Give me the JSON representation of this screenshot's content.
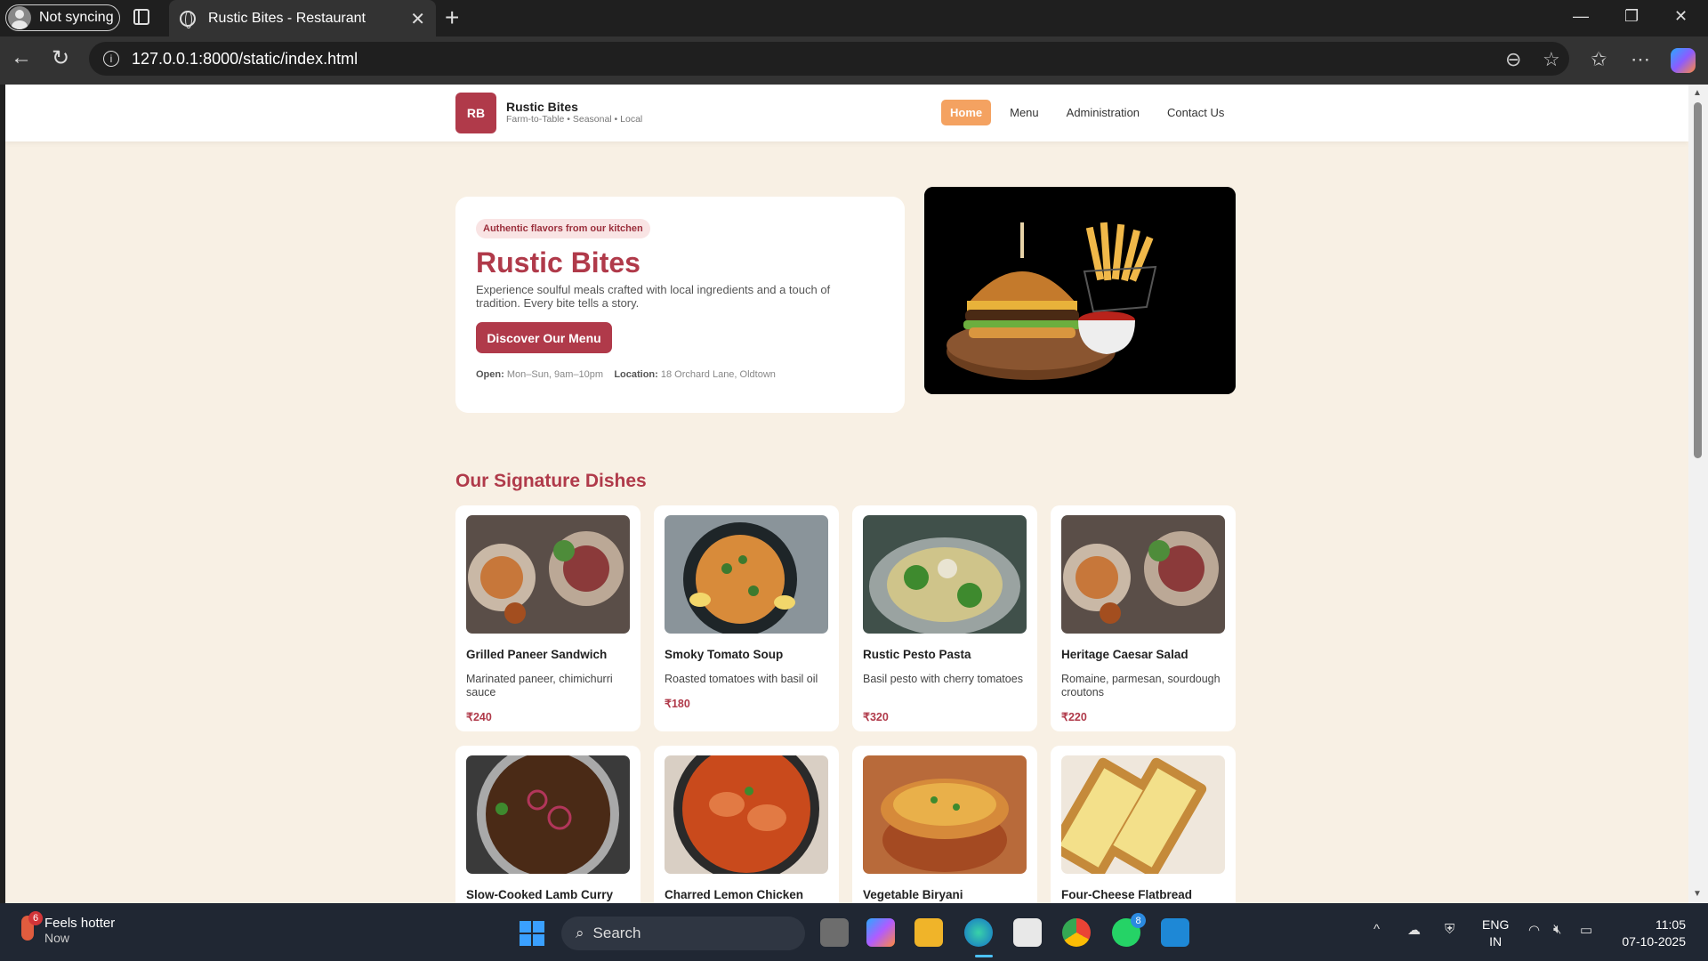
{
  "browser": {
    "profile_label": "Not syncing",
    "tab_title": "Rustic Bites - Restaurant",
    "url": "127.0.0.1:8000/static/index.html"
  },
  "site": {
    "logo_text": "RB",
    "brand_name": "Rustic Bites",
    "brand_tagline": "Farm-to-Table • Seasonal • Local",
    "nav": [
      {
        "label": "Home",
        "active": true
      },
      {
        "label": "Menu",
        "active": false
      },
      {
        "label": "Administration",
        "active": false
      },
      {
        "label": "Contact Us",
        "active": false
      }
    ],
    "accent_color": "#b03a4a",
    "nav_active_color": "#f4a261",
    "background_color": "#f8f0e4"
  },
  "hero": {
    "pill": "Authentic flavors from our kitchen",
    "title": "Rustic Bites",
    "description": "Experience soulful meals crafted with local ingredients and a touch of tradition. Every bite tells a story.",
    "cta_label": "Discover Our Menu",
    "open_label": "Open:",
    "open_value": "Mon–Sun, 9am–10pm",
    "location_label": "Location:",
    "location_value": "18 Orchard Lane, Oldtown"
  },
  "signature": {
    "title": "Our Signature Dishes",
    "dishes": [
      {
        "name": "Grilled Paneer Sandwich",
        "desc": "Marinated paneer, chimichurri sauce",
        "price": "₹240"
      },
      {
        "name": "Smoky Tomato Soup",
        "desc": "Roasted tomatoes with basil oil",
        "price": "₹180"
      },
      {
        "name": "Rustic Pesto Pasta",
        "desc": "Basil pesto with cherry tomatoes",
        "price": "₹320"
      },
      {
        "name": "Heritage Caesar Salad",
        "desc": "Romaine, parmesan, sourdough croutons",
        "price": "₹220"
      },
      {
        "name": "Slow-Cooked Lamb Curry"
      },
      {
        "name": "Charred Lemon Chicken"
      },
      {
        "name": "Vegetable Biryani"
      },
      {
        "name": "Four-Cheese Flatbread"
      }
    ]
  },
  "taskbar": {
    "weather_badge": "6",
    "weather_title": "Feels hotter",
    "weather_sub": "Now",
    "search_label": "Search",
    "whatsapp_badge": "8",
    "lang_top": "ENG",
    "lang_bottom": "IN",
    "time": "11:05",
    "date": "07-10-2025"
  }
}
